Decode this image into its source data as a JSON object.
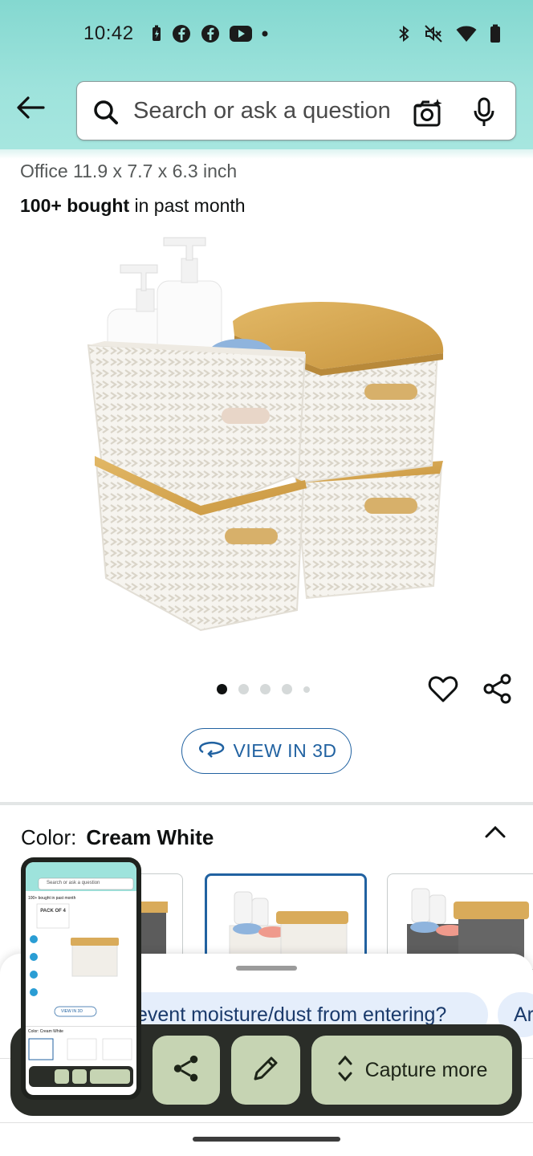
{
  "status_bar": {
    "time": "10:42",
    "left_icons": [
      "battery-saver-icon",
      "facebook-icon",
      "facebook-icon",
      "youtube-icon",
      "dot-icon"
    ],
    "right_icons": [
      "bluetooth-icon",
      "mute-icon",
      "wifi-icon",
      "battery-icon"
    ]
  },
  "search": {
    "placeholder": "Search or ask a question"
  },
  "product": {
    "subtitle": "Office 11.9 x 7.7 x 6.3 inch",
    "bought_bold": "100+ bought",
    "bought_rest": " in past month",
    "image_count": 5,
    "active_image": 1,
    "view_3d_label": "VIEW IN 3D"
  },
  "color": {
    "label": "Color:",
    "value": "Cream White"
  },
  "suggestions": [
    "event moisture/dust from entering?",
    "Ar"
  ],
  "capture_toolbar": {
    "capture_more_label": "Capture more"
  },
  "thumbnail": {
    "search_text": "Search or ask a question",
    "bought_text": "100+ bought in past month",
    "pack_text": "PACK OF 4",
    "view3d_text": "VIEW IN 3D",
    "color_text": "Color: Cream White"
  },
  "colors": {
    "header_teal": "#9ee3dc",
    "link_blue": "#2162a1",
    "capture_button": "#c6d4b3",
    "capture_bar": "#2a2d28"
  }
}
